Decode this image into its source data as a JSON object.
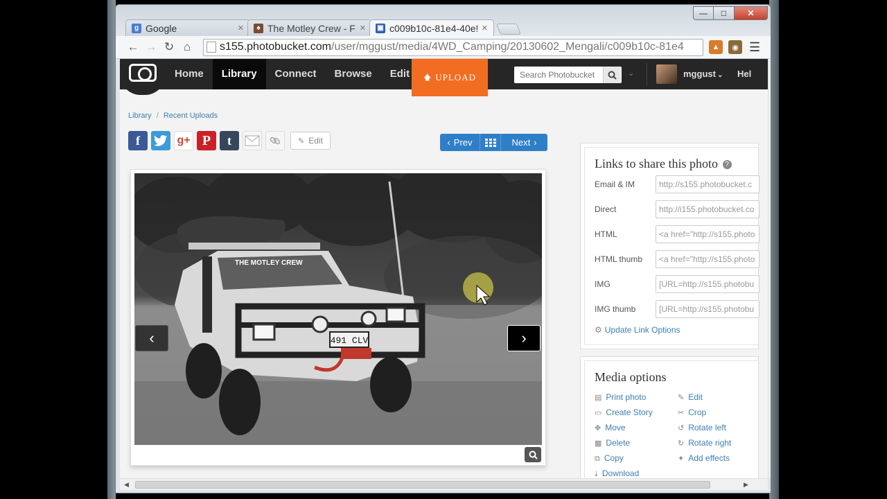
{
  "browser": {
    "tabs": [
      {
        "title": "Google",
        "favicon": "google-favicon",
        "active": false
      },
      {
        "title": "The Motley Crew - Fr",
        "favicon": "motley-crew-favicon",
        "active": false
      },
      {
        "title": "c009b10c-81e4-40e!",
        "favicon": "photobucket-favicon",
        "active": true
      }
    ],
    "url_host": "s155.photobucket.com",
    "url_path": "/user/mggust/media/4WD_Camping/20130602_Mengali/c009b10c-81e4"
  },
  "nav": {
    "links": [
      "Home",
      "Library",
      "Connect",
      "Browse",
      "Edit"
    ],
    "active": "Library",
    "upload_label": "UPLOAD",
    "search_placeholder": "Search Photobucket",
    "username": "mggust",
    "help_label": "Hel"
  },
  "breadcrumb": {
    "root": "Library",
    "separator": "/",
    "current": "Recent Uploads"
  },
  "share": {
    "icons": [
      "facebook",
      "twitter",
      "google-plus",
      "pinterest",
      "tumblr",
      "email",
      "link"
    ],
    "edit_label": "Edit"
  },
  "pager": {
    "prev_label": "Prev",
    "next_label": "Next"
  },
  "photo": {
    "alt": "White 4WD with rooftop tent parked on grass",
    "plate_text": "491 CLV",
    "banner_text": "THE MOTLEY CREW"
  },
  "links_panel": {
    "title": "Links to share this photo",
    "rows": [
      {
        "label": "Email & IM",
        "value": "http://s155.photobucket.c"
      },
      {
        "label": "Direct",
        "value": "http://i155.photobucket.co"
      },
      {
        "label": "HTML",
        "value": "<a href=\"http://s155.photo"
      },
      {
        "label": "HTML thumb",
        "value": "<a href=\"http://s155.photo"
      },
      {
        "label": "IMG",
        "value": "[URL=http://s155.photobu"
      },
      {
        "label": "IMG thumb",
        "value": "[URL=http://s155.photobu"
      }
    ],
    "update_label": "Update Link Options"
  },
  "media_panel": {
    "title": "Media options",
    "left": [
      "Print photo",
      "Create Story",
      "Move",
      "Delete",
      "Copy",
      "Download"
    ],
    "right": [
      "Edit",
      "Crop",
      "Rotate left",
      "Rotate right",
      "Add effects"
    ]
  },
  "colors": {
    "accent": "#f26d21",
    "nav_bg": "#262626",
    "link": "#3c7fb1",
    "pager": "#2f7fc8"
  }
}
